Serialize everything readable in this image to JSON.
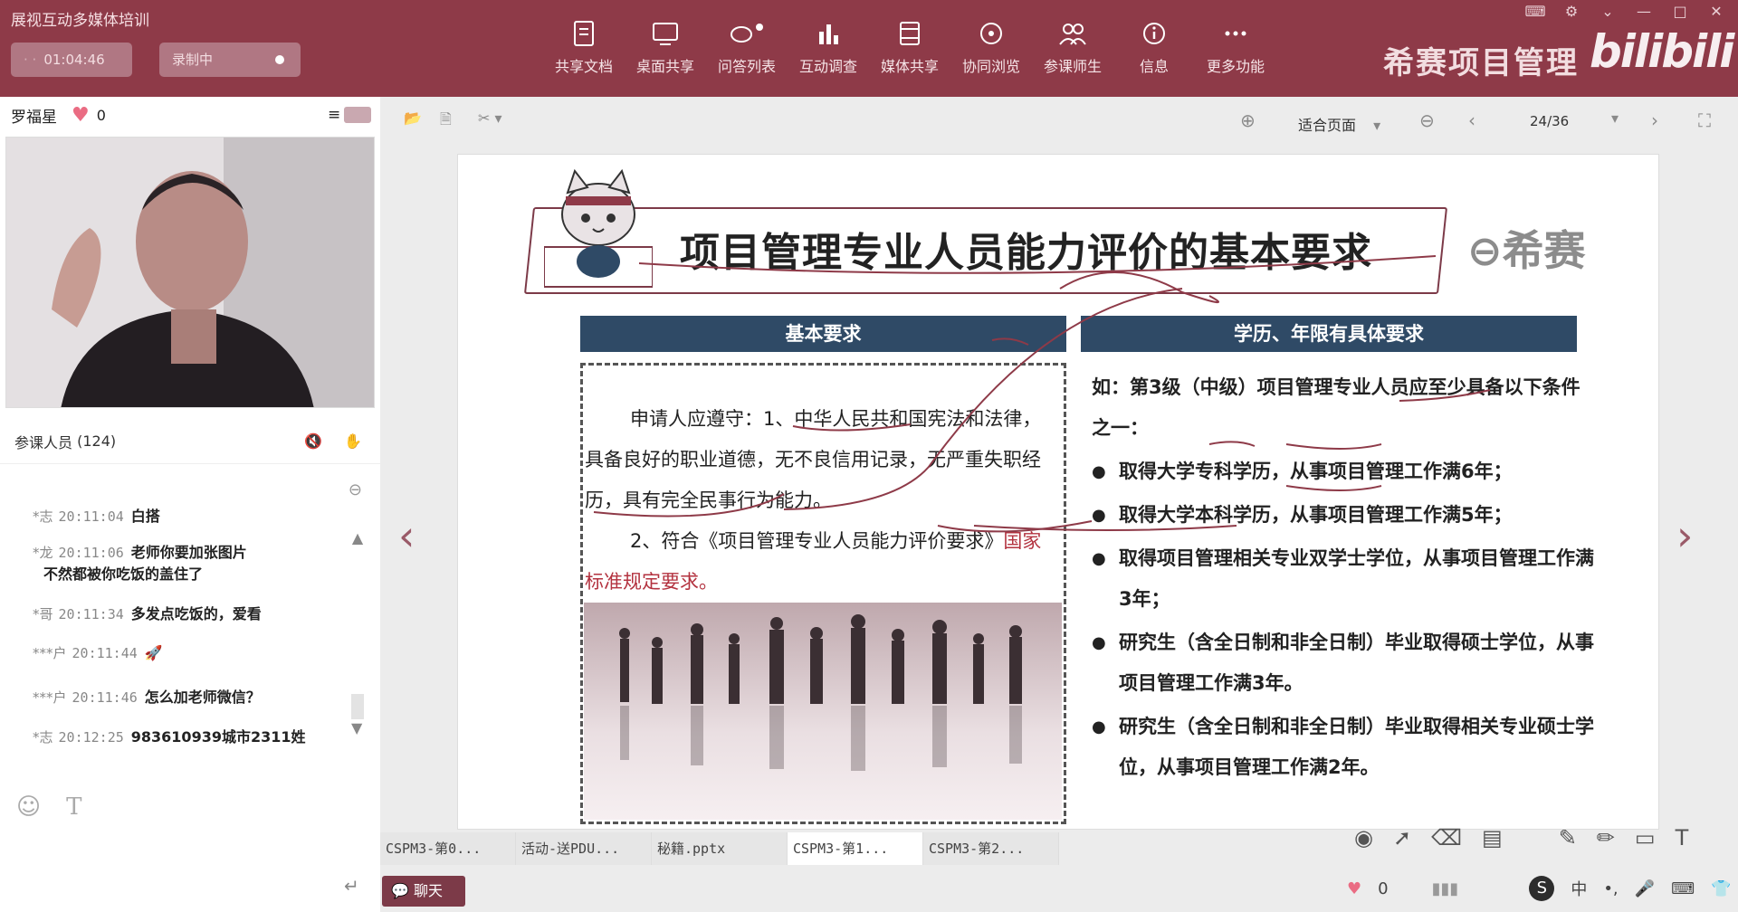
{
  "window": {
    "title": "展视互动多媒体培训",
    "timer": "01:04:46",
    "record_label": "录制中"
  },
  "toolbar": [
    {
      "name": "share-doc",
      "label": "共享文档"
    },
    {
      "name": "desktop-share",
      "label": "桌面共享"
    },
    {
      "name": "qa-list",
      "label": "问答列表"
    },
    {
      "name": "survey",
      "label": "互动调查"
    },
    {
      "name": "media-share",
      "label": "媒体共享"
    },
    {
      "name": "co-browse",
      "label": "协同浏览"
    },
    {
      "name": "participants",
      "label": "参课师生"
    },
    {
      "name": "info",
      "label": "信息"
    },
    {
      "name": "more",
      "label": "更多功能"
    }
  ],
  "brand": {
    "name": "希赛项目管理",
    "logo_text": "bilibili"
  },
  "speaker": {
    "name": "罗福星",
    "likes": "0"
  },
  "attendees": {
    "label": "参课人员",
    "count": "(124)"
  },
  "chat": {
    "messages": [
      {
        "who": "*志",
        "time": "20:11:04",
        "text": "白搭"
      },
      {
        "who": "*龙",
        "time": "20:11:06",
        "text": "老师你要加张图片",
        "text2": "不然都被你吃饭的盖住了"
      },
      {
        "who": "*哥",
        "time": "20:11:34",
        "text": "多发点吃饭的，爱看"
      },
      {
        "who": "***户",
        "time": "20:11:44",
        "text": "🚀"
      },
      {
        "who": "***户",
        "time": "20:11:46",
        "text": "怎么加老师微信？"
      },
      {
        "who": "*志",
        "time": "20:12:25",
        "text": "983610939城市2311姓"
      }
    ]
  },
  "doc_toolbar": {
    "zoom": "适合页面",
    "page": "24/36"
  },
  "slide": {
    "title": "项目管理专业人员能力评价的基本要求",
    "logo": "希赛",
    "left_header": "基本要求",
    "right_header": "学历、年限有具体要求",
    "left_p1": "申请人应遵守：1、中华人民共和国宪法和法律，具备良好的职业道德，无不良信用记录，无严重失职经历，具有完全民事行为能力。",
    "left_p2": "2、符合《项目管理专业人员能力评价要求》",
    "left_p2_red": "国家标准规定要求。",
    "right_intro": "如：第3级（中级）项目管理专业人员应至少具备以下条件之一：",
    "bullets": [
      "取得大学专科学历，从事项目管理工作满6年；",
      "取得大学本科学历，从事项目管理工作满5年；",
      "取得项目管理相关专业双学士学位，从事项目管理工作满3年；",
      "研究生（含全日制和非全日制）毕业取得硕士学位，从事项目管理工作满3年。",
      "研究生（含全日制和非全日制）毕业取得相关专业硕士学位，从事项目管理工作满2年。"
    ]
  },
  "tabs": [
    "CSPM3-第0...",
    "活动-送PDU...",
    "秘籍.pptx",
    "CSPM3-第1...",
    "CSPM3-第2..."
  ],
  "chat_button": "聊天",
  "tray": {
    "likes": "0",
    "ime": "中"
  },
  "colors": {
    "topbar": "#8e3a48",
    "accent": "#7c3a48",
    "header_blue": "#2f4a66"
  }
}
